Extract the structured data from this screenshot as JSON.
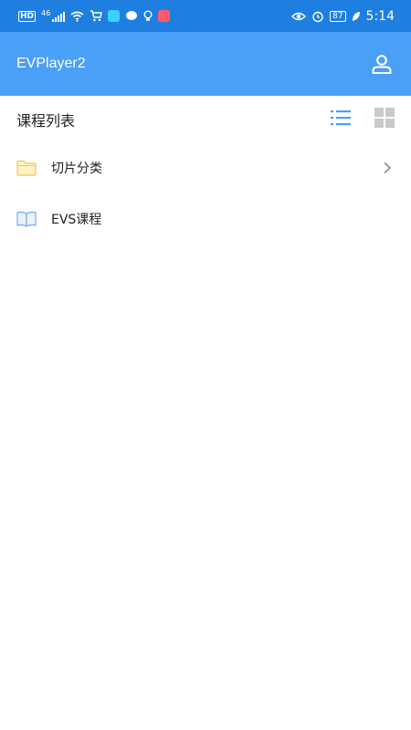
{
  "status_bar": {
    "hd": "HD",
    "signal": "46",
    "battery": "87",
    "time": "5:14"
  },
  "app_bar": {
    "title": "EVPlayer2",
    "profile_icon": "user-icon"
  },
  "list_header": {
    "title": "课程列表",
    "list_view_icon": "list-view-icon",
    "grid_view_icon": "grid-view-icon",
    "active_view": "list"
  },
  "rows": [
    {
      "label": "切片分类",
      "icon": "folder-icon",
      "has_chevron": true
    },
    {
      "label": "EVS课程",
      "icon": "book-icon",
      "has_chevron": false
    }
  ],
  "colors": {
    "status_bar": "#1f7fe0",
    "app_bar": "#4a9ff7",
    "accent": "#4a9ff7",
    "folder": "#f3d36b",
    "book": "#7fb3e6"
  }
}
